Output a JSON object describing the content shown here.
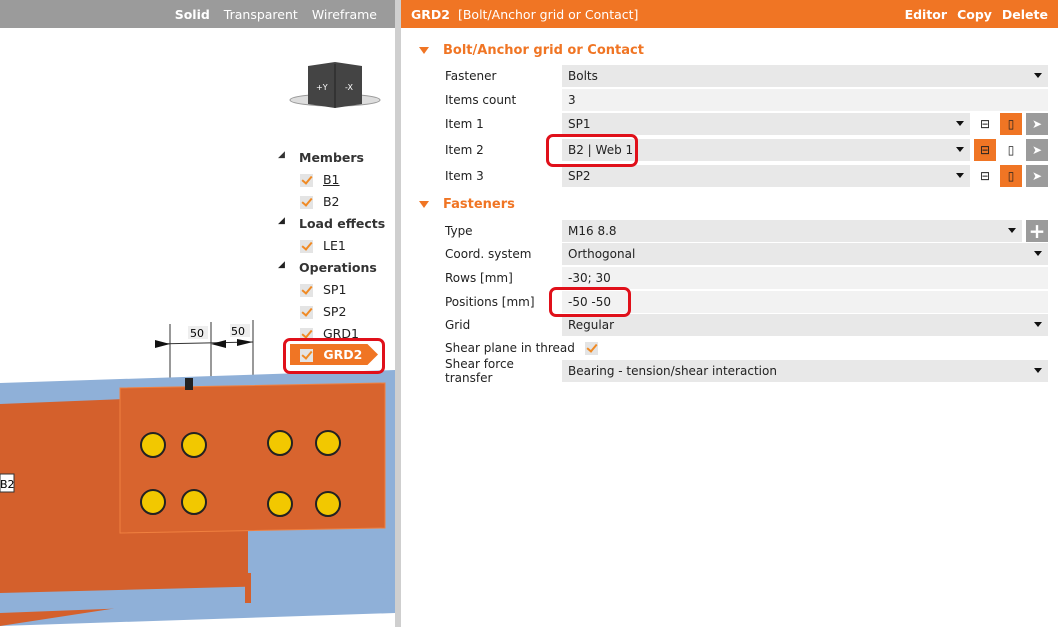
{
  "viewport": {
    "modes": [
      "Solid",
      "Transparent",
      "Wireframe"
    ],
    "active_mode": "Solid",
    "cube_faces": [
      "+Y",
      "-X"
    ],
    "dims": [
      "50",
      "50"
    ],
    "member_tag": "B2"
  },
  "tree": {
    "groups": [
      {
        "label": "Members",
        "items": [
          "B1",
          "B2"
        ]
      },
      {
        "label": "Load effects",
        "items": [
          "LE1"
        ]
      },
      {
        "label": "Operations",
        "items": [
          "SP1",
          "SP2",
          "GRD1",
          "GRD2"
        ]
      }
    ],
    "selected": "GRD2"
  },
  "header": {
    "name": "GRD2",
    "type": "[Bolt/Anchor grid or Contact]",
    "actions": [
      "Editor",
      "Copy",
      "Delete"
    ]
  },
  "sections": {
    "s1": "Bolt/Anchor grid or Contact",
    "s2": "Fasteners"
  },
  "fields": {
    "fastener": {
      "label": "Fastener",
      "value": "Bolts"
    },
    "items_count": {
      "label": "Items count",
      "value": "3"
    },
    "item1": {
      "label": "Item 1",
      "value": "SP1"
    },
    "item2": {
      "label": "Item 2",
      "value": "B2 | Web 1"
    },
    "item3": {
      "label": "Item 3",
      "value": "SP2"
    },
    "type": {
      "label": "Type",
      "value": "M16 8.8"
    },
    "coord": {
      "label": "Coord. system",
      "value": "Orthogonal"
    },
    "rows": {
      "label": "Rows [mm]",
      "value": "-30; 30"
    },
    "positions": {
      "label": "Positions [mm]",
      "value": "-50 -50"
    },
    "grid": {
      "label": "Grid",
      "value": "Regular"
    },
    "shear_plane": {
      "label": "Shear plane in thread",
      "checked": true
    },
    "shear_force": {
      "label": "Shear force transfer",
      "value": "Bearing - tension/shear interaction"
    }
  },
  "colors": {
    "accent": "#f07524",
    "highlight": "#e0101a",
    "bolt": "#f2c800",
    "plate": "#d4602c",
    "flange": "#8fb0d8"
  }
}
